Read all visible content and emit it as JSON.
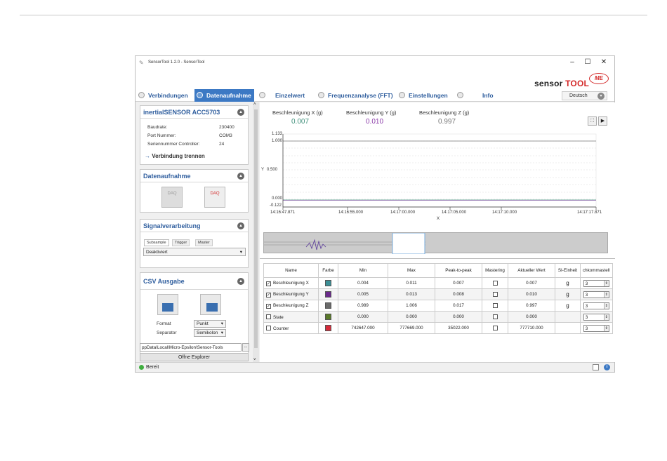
{
  "window": {
    "title": "SensorTool 1.2.0 - SensorTool"
  },
  "brand": {
    "sensor": "sensor",
    "tool": "TOOL",
    "me_logo": "ME"
  },
  "tabs": [
    {
      "label": "Verbindungen"
    },
    {
      "label": "Datenaufnahme"
    },
    {
      "label": "Einzelwert"
    },
    {
      "label": "Frequenzanalyse (FFT)"
    },
    {
      "label": "Einstellungen"
    },
    {
      "label": "Info"
    }
  ],
  "language": "Deutsch",
  "device": {
    "name": "inertialSENSOR ACC5703",
    "baud_label": "Baudrate:",
    "baud_value": "230400",
    "port_label": "Port Nummer:",
    "port_value": "COM3",
    "serial_label": "Seriennummer Controller:",
    "serial_value": "24",
    "disconnect": "Verbindung trennen"
  },
  "acquisition": {
    "title": "Datenaufnahme",
    "btn1": "DAQ",
    "btn2": "DAQ"
  },
  "signal": {
    "title": "Signalverarbeitung",
    "tabs": [
      "Subsample",
      "Trigger",
      "Master"
    ],
    "select": "Deaktiviert"
  },
  "csv": {
    "title": "CSV Ausgabe",
    "format_label": "Format",
    "format_value": "Punkt",
    "separator_label": "Separator",
    "separator_value": "Semikolon",
    "path": "ppData\\Local\\Micro-Epsilon\\Sensor-Tools",
    "browse": "...",
    "open_explorer": "Offne Explorer"
  },
  "readings": [
    {
      "label": "Beschleunigung X  (g)",
      "value": "0.007",
      "color": "#3f8f7a"
    },
    {
      "label": "Beschleunigung Y  (g)",
      "value": "0.010",
      "color": "#8a3aa8"
    },
    {
      "label": "Beschleunigung Z  (g)",
      "value": "0.997",
      "color": "#777777"
    }
  ],
  "plot": {
    "y_axis_label": "Y",
    "x_axis_label": "X",
    "y_ticks": [
      "1.133",
      "1.000",
      "0.500",
      "0.000",
      "-0.122"
    ],
    "x_ticks": [
      "14:16:47.871",
      "14:16:55.000",
      "14:17:00.000",
      "14:17:05.000",
      "14:17:10.000",
      "14:17:17.871"
    ]
  },
  "table": {
    "headers": [
      "Name",
      "Farbe",
      "Min",
      "Max",
      "Peak-to-peak",
      "Mastering",
      "Aktueller Wert",
      "SI-Einheit",
      "chkommastell"
    ],
    "rows": [
      {
        "checked": "✓",
        "name": "Beschleunigung X",
        "color": "#3c8f96",
        "min": "0.004",
        "max": "0.011",
        "ptp": "0.007",
        "current": "0.007",
        "unit": "g",
        "decimals": "3"
      },
      {
        "checked": "✓",
        "name": "Beschleunigung Y",
        "color": "#6b2a8c",
        "min": "0.005",
        "max": "0.013",
        "ptp": "0.008",
        "current": "0.010",
        "unit": "g",
        "decimals": "3"
      },
      {
        "checked": "✓",
        "name": "Beschleunigung Z",
        "color": "#6a6a6a",
        "min": "0.989",
        "max": "1.006",
        "ptp": "0.017",
        "current": "0.997",
        "unit": "g",
        "decimals": "3"
      },
      {
        "checked": "",
        "name": "State",
        "color": "#5a7a2a",
        "min": "0.000",
        "max": "0.000",
        "ptp": "0.000",
        "current": "0.000",
        "unit": "",
        "decimals": "3"
      },
      {
        "checked": "",
        "name": "Counter",
        "color": "#d62b3a",
        "min": "742647.000",
        "max": "777669.000",
        "ptp": "35022.000",
        "current": "777710.000",
        "unit": "",
        "decimals": "3"
      }
    ]
  },
  "status": "Bereit"
}
